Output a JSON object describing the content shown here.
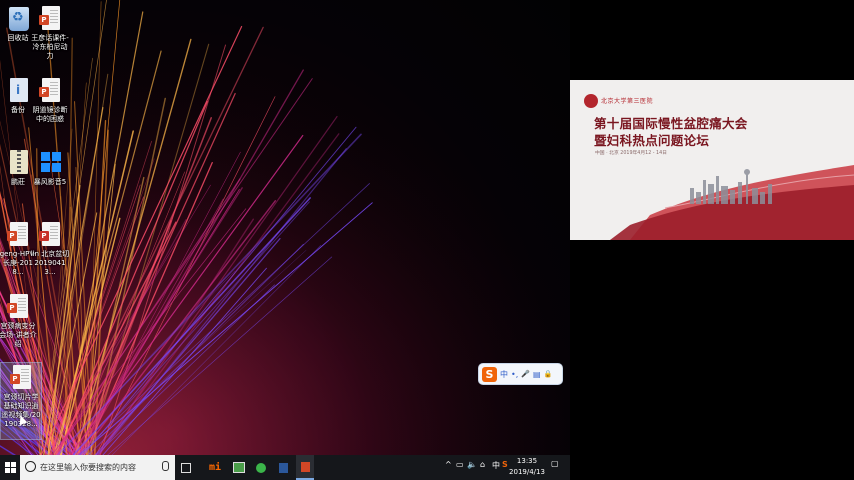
{
  "desktop": {
    "icons": [
      {
        "label": "回收站"
      },
      {
        "label": "王彦话课件-冷东柏尼动力"
      },
      {
        "label": "备份"
      },
      {
        "label": "阴道镜诊断中的困惑"
      },
      {
        "label": "鹏莊"
      },
      {
        "label": "暴风影音5"
      },
      {
        "label": "geng-HPV-长庚-2018..."
      },
      {
        "label": "lin 北京盆切20190413..."
      },
      {
        "label": "宫颈病变分会场-讲者介绍"
      },
      {
        "label": "宫颈切片学基础知识逍遥视频集/20190328..."
      }
    ]
  },
  "slide": {
    "org": "北京大学第三医院",
    "title_line1": "第十届国际慢性盆腔痛大会",
    "title_line2": "暨妇科热点问题论坛",
    "date": "中国 · 北京  2019年4月12 - 14日"
  },
  "ime": {
    "lang": "中",
    "punct": "•,",
    "mic": "🎤",
    "keyboard": "▤",
    "skin": "🔒"
  },
  "taskbar": {
    "search_placeholder": "在这里输入你要搜索的内容",
    "time": "13:35",
    "date": "2019/4/13",
    "lang_indicator": "中",
    "tray_chevron": "^"
  },
  "colors": {
    "taskbar": "#15171b",
    "slide_title": "#7a1620",
    "ime_orange": "#f0640a"
  }
}
